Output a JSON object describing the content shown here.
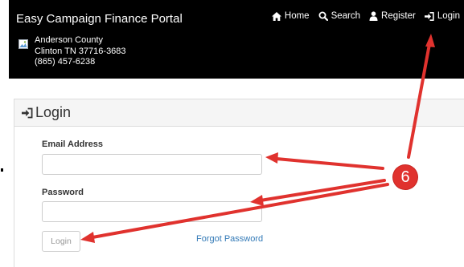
{
  "header": {
    "title": "Easy Campaign Finance Portal",
    "org": {
      "logo_icon": "broken-image-icon",
      "name": "Anderson County",
      "address": "Clinton TN 37716-3683",
      "phone": "(865) 457-6238"
    },
    "nav": [
      {
        "label": "Home",
        "icon": "home-icon"
      },
      {
        "label": "Search",
        "icon": "search-icon"
      },
      {
        "label": "Register",
        "icon": "user-icon"
      },
      {
        "label": "Login",
        "icon": "login-icon"
      }
    ]
  },
  "login_panel": {
    "title": "Login",
    "title_icon": "login-icon",
    "email_label": "Email Address",
    "email_value": "",
    "password_label": "Password",
    "password_value": "",
    "login_button": "Login",
    "forgot_link": "Forgot Password"
  },
  "annotation": {
    "step_number": "6",
    "color": "#e0322e"
  },
  "colors": {
    "header_bg": "#000000",
    "link": "#337ab7",
    "panel_heading_bg": "#f5f5f5"
  }
}
